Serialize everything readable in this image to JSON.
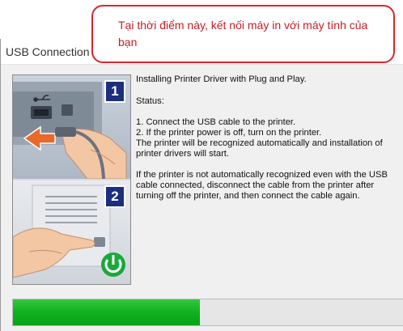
{
  "window": {
    "title": "USB Connection"
  },
  "callout": {
    "text": "Tại thời điểm này, kết nối máy in với máy tính của bạn"
  },
  "steps": [
    {
      "number": "1"
    },
    {
      "number": "2"
    }
  ],
  "description": {
    "heading": "Installing Printer Driver with Plug and Play.",
    "status_label": "Status:",
    "step1": "1. Connect the USB cable to the printer.",
    "step2": "2. If the printer power is off, turn on the printer.",
    "recognize": "The printer will be recognized automatically and installation of printer drivers will start.",
    "troubleshoot": "If the printer is not automatically recognized even with the USB cable connected, disconnect the cable from the printer after turning off the printer, and then connect the cable again."
  },
  "progress": {
    "value": 0.48,
    "color": "#10b020"
  },
  "colors": {
    "callout_border": "#d9262e",
    "callout_text": "#c2202a",
    "step_badge": "#1c2f7c",
    "power_icon": "#19a83a",
    "arrow": "#e8692a"
  },
  "icons": [
    "usb-icon",
    "usb-connect-arrow-icon",
    "power-icon"
  ]
}
